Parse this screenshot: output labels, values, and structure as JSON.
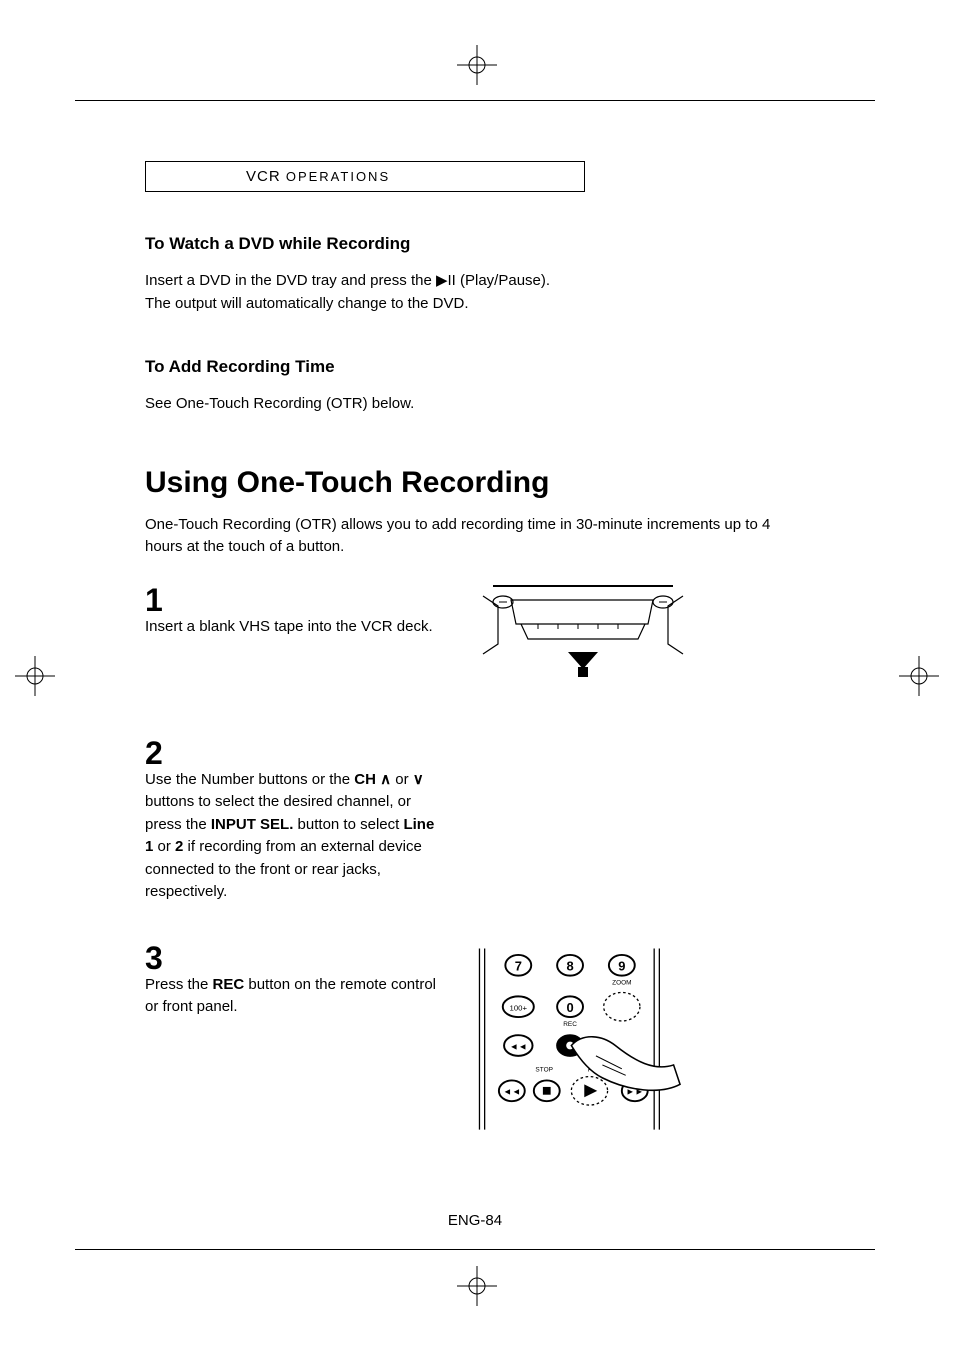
{
  "crop_marks": true,
  "section_label": {
    "prefix": "VCR ",
    "suffix": "OPERATIONS"
  },
  "sub1": {
    "heading": "To Watch a DVD while Recording",
    "body": "Insert a DVD in the DVD tray and press the ▶II (Play/Pause). The output will automatically change to the DVD."
  },
  "sub2": {
    "heading": "To Add Recording Time",
    "body": "See One-Touch Recording (OTR) below."
  },
  "main": {
    "heading": "Using One-Touch Recording",
    "intro": "One-Touch Recording (OTR) allows you to add recording time in 30-minute increments up to 4 hours at the touch of a button."
  },
  "steps": {
    "s1": {
      "num": "1",
      "text": "Insert a blank VHS tape into the VCR deck."
    },
    "s2": {
      "num": "2",
      "text_before": "Use the Number buttons or the ",
      "ch_label": "CH",
      "text_or": " or ",
      "text_mid": " buttons to select the desired channel, or press the ",
      "input_sel": "INPUT SEL.",
      "text_mid2": " button to select ",
      "line1": "Line 1",
      "text_or2": " or ",
      "line2": "2",
      "text_after": " if recording from an external device connected to the front or rear jacks, respectively."
    },
    "s3": {
      "num": "3",
      "text_before": "Press the ",
      "rec": "REC",
      "text_after": " button on the remote control or front panel."
    }
  },
  "remote_labels": {
    "zoom": "ZOOM",
    "rec": "REC",
    "stop": "STOP",
    "play": "PLAY"
  },
  "page_number": "ENG-84"
}
